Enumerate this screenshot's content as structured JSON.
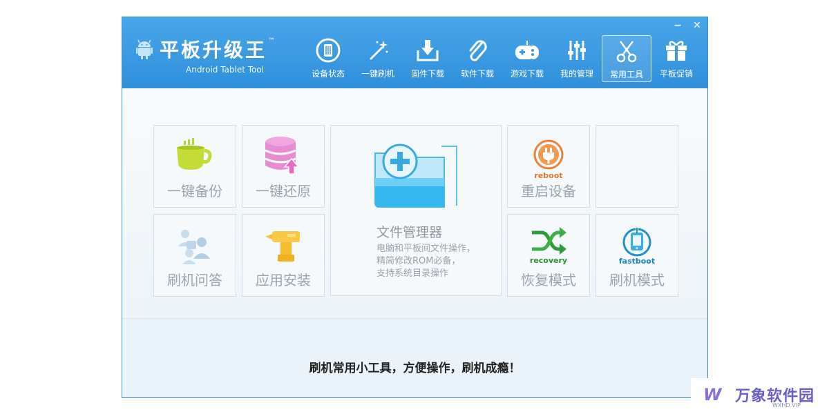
{
  "app": {
    "title": "平板升级王",
    "trademark": "™",
    "subtitle": "Android Tablet Tool",
    "minimize": "−",
    "close": "✕"
  },
  "nav": [
    {
      "label": "设备状态",
      "icon": "device-status-icon",
      "active": false
    },
    {
      "label": "一键刷机",
      "icon": "magic-wand-icon",
      "active": false
    },
    {
      "label": "固件下载",
      "icon": "firmware-download-icon",
      "active": false
    },
    {
      "label": "软件下载",
      "icon": "paperclip-icon",
      "active": false
    },
    {
      "label": "游戏下载",
      "icon": "gamepad-icon",
      "active": false
    },
    {
      "label": "我的管理",
      "icon": "sliders-icon",
      "active": false
    },
    {
      "label": "常用工具",
      "icon": "scissors-icon",
      "active": true
    },
    {
      "label": "平板促销",
      "icon": "gift-icon",
      "active": false
    }
  ],
  "tools": {
    "backup": {
      "label": "一键备份",
      "icon": "cup-icon"
    },
    "restore": {
      "label": "一键还原",
      "icon": "database-restore-icon"
    },
    "faq": {
      "label": "刷机问答",
      "icon": "users-faq-icon"
    },
    "install": {
      "label": "应用安装",
      "icon": "drill-install-icon"
    },
    "file_manager": {
      "label": "文件管理器",
      "icon": "folder-add-icon",
      "desc_line1": "电脑和平板间文件操作，",
      "desc_line2": "精简修改ROM必备，",
      "desc_line3": "支持系统目录操作"
    },
    "reboot": {
      "label": "重启设备",
      "badge": "reboot",
      "icon": "power-plug-icon"
    },
    "recovery": {
      "label": "恢复模式",
      "badge": "recovery",
      "icon": "shuffle-arrows-icon"
    },
    "fastboot": {
      "label": "刷机模式",
      "badge": "fastboot",
      "icon": "phone-power-icon"
    },
    "empty": {
      "label": ""
    }
  },
  "footer": {
    "slogan": "刷机常用小工具，方便操作，刷机成瘾！"
  },
  "watermark": {
    "logo": "W",
    "text": "万象软件园",
    "sub": "WXHD.VIP"
  },
  "colors": {
    "titlebar": "#3a9be3",
    "tile_border": "#d3dde5",
    "reboot": "#e8833a",
    "recovery": "#2f9b3a",
    "fastboot": "#1e8fc8"
  }
}
